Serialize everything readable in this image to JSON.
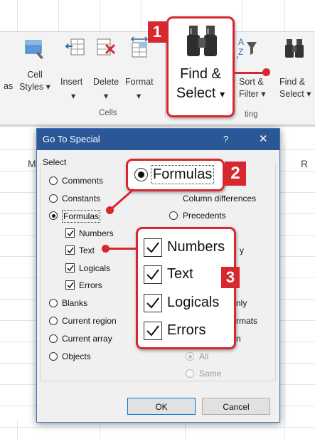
{
  "ribbon": {
    "cut_label": "as",
    "cell_styles": [
      "Cell",
      "Styles"
    ],
    "insert": "Insert",
    "delete": "Delete",
    "format": "Format",
    "cells_group": "Cells",
    "editing_group": "ting",
    "sort_filter": [
      "Sort &",
      "Filter"
    ],
    "find_select": [
      "Find &",
      "Select"
    ],
    "find_select_big": [
      "Find &",
      "Select"
    ]
  },
  "sheet": {
    "col_left": "M",
    "col_right": "R"
  },
  "dialog": {
    "title": "Go To Special",
    "help": "?",
    "close": "✕",
    "group_label": "Select",
    "left_options": [
      "Comments",
      "Constants",
      "Formulas",
      "Blanks",
      "Current region",
      "Current array",
      "Objects"
    ],
    "formula_subs": [
      "Numbers",
      "Text",
      "Logicals",
      "Errors"
    ],
    "right_options": [
      "Column differences",
      "Precedents"
    ],
    "right_partial": [
      "y",
      "nly",
      "rmats",
      "n"
    ],
    "dependents_subs": [
      "All",
      "Same"
    ],
    "ok": "OK",
    "cancel": "Cancel",
    "selected": "Formulas"
  },
  "callouts": {
    "step1": "1",
    "step2": "2",
    "step3": "3",
    "formulas_label": "Formulas",
    "items": [
      "Numbers",
      "Text",
      "Logicals",
      "Errors"
    ]
  },
  "colors": {
    "accent_red": "#d7282f",
    "dialog_title": "#2b5797"
  }
}
